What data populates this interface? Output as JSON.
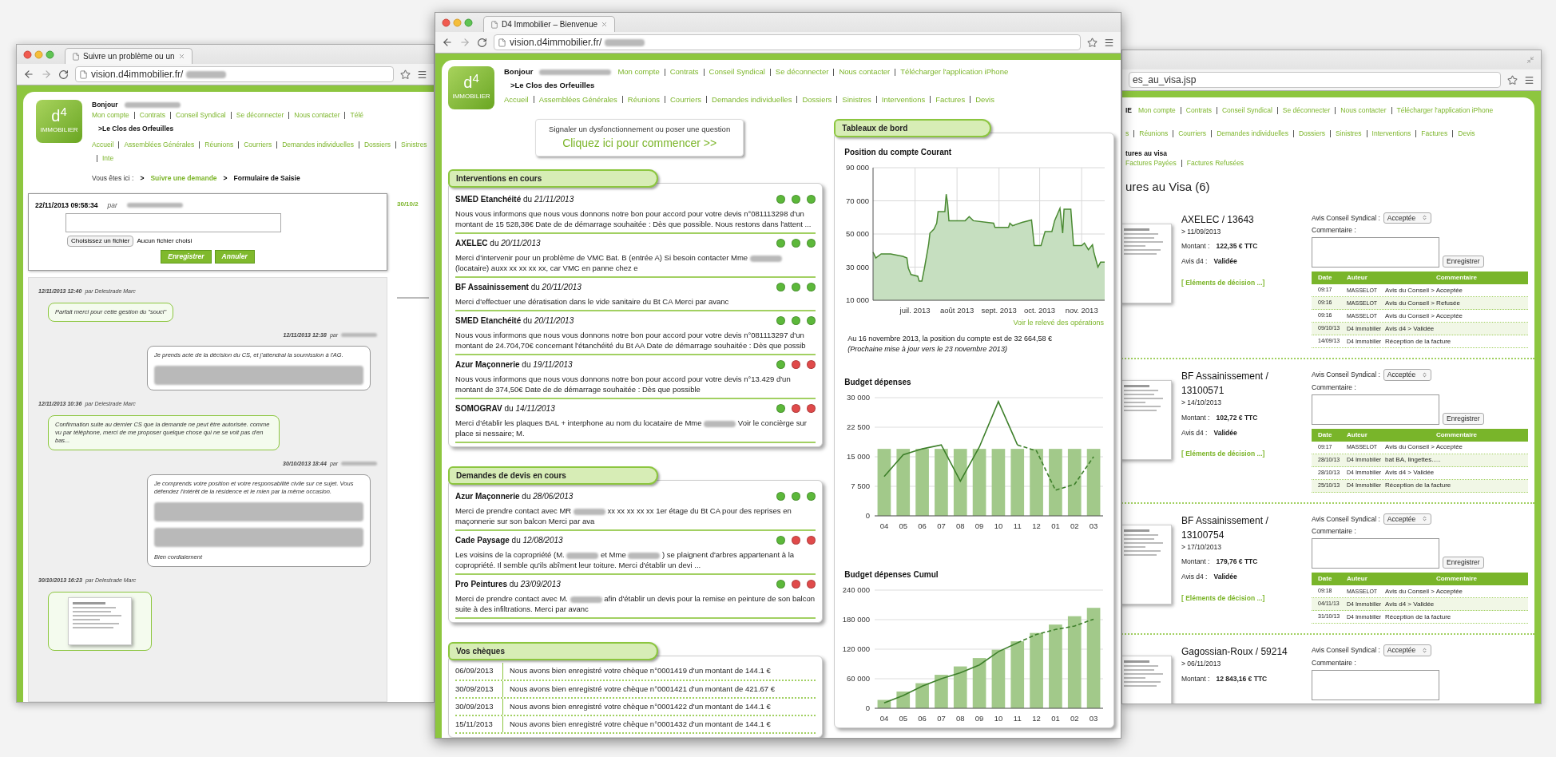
{
  "left_window": {
    "tab_title": "Suivre un problème ou un",
    "url": "vision.d4immobilier.fr/",
    "logo": {
      "mark": "d$^{4}$",
      "tagline": "IMMOBILIER"
    },
    "greeting": "Bonjour",
    "residence": ">Le Clos des Orfeuilles",
    "top_links": [
      "Mon compte",
      "Contrats",
      "Conseil Syndical",
      "Se déconnecter",
      "Nous contacter",
      "Télé"
    ],
    "nav_links": [
      "Accueil",
      "Assemblées Générales",
      "Réunions",
      "Courriers",
      "Demandes individuelles",
      "Dossiers",
      "Sinistres",
      "Inte"
    ],
    "breadcrumb": {
      "label": "Vous êtes ici :",
      "separator": ">",
      "items": [
        {
          "text": "Suivre une demande",
          "kind": "link"
        },
        {
          "text": "Formulaire de Saisie",
          "kind": "current"
        }
      ]
    },
    "form": {
      "timestamp": "22/11/2013 09:58:34",
      "by": "par",
      "file_button": "Choisissez un fichier",
      "file_status": "Aucun fichier choisi",
      "buttons": [
        "Enregistrer",
        "Annuler"
      ]
    },
    "side_date": "30/10/2",
    "messages": [
      {
        "kind": "left",
        "date": "12/11/2013 12:40",
        "by": "par Delestrade Marc",
        "body": [
          {
            "kind": "text",
            "text": "Parfait merci pour cette gestion du \"souci\""
          }
        ]
      },
      {
        "kind": "right",
        "date": "12/11/2013 12:38",
        "by": "par",
        "body": [
          {
            "kind": "text",
            "text": "Je prends acte de la décision du CS, et j'attendrai la soumission à l'AG."
          },
          {
            "kind": "blurred"
          }
        ]
      },
      {
        "kind": "left",
        "date": "12/11/2013 10:36",
        "by": "par Delestrade Marc",
        "body": [
          {
            "kind": "text",
            "text": "Confirmation suite au dernier CS que la demande ne peut être autorisée. comme vu par téléphone, merci de me proposer quelque chose qui ne se voit pas d'en bas..."
          }
        ]
      },
      {
        "kind": "right",
        "date": "30/10/2013 18:44",
        "by": "par",
        "body": [
          {
            "kind": "text",
            "text": "Je comprends votre position et votre responsabilité civile sur ce sujet. Vous défendez l'intérêt de la résidence et le mien par la même occasion."
          },
          {
            "kind": "blurred"
          },
          {
            "kind": "blurred"
          },
          {
            "kind": "text",
            "text": "Bien cordialement"
          }
        ]
      },
      {
        "kind": "left",
        "date": "30/10/2013 16:23",
        "by": "par Delestrade Marc",
        "body": [
          {
            "kind": "document"
          }
        ]
      }
    ]
  },
  "center_window": {
    "tab_title": "D4 Immobilier – Bienvenue",
    "url": "vision.d4immobilier.fr/",
    "logo": {
      "mark": "d$^{4}$",
      "tagline": "IMMOBILIER"
    },
    "greeting": "Bonjour",
    "residence": ">Le Clos des Orfeuilles",
    "top_links": [
      "Mon compte",
      "Contrats",
      "Conseil Syndical",
      "Se déconnecter",
      "Nous contacter",
      "Télécharger l'application iPhone"
    ],
    "nav_links": [
      "Accueil",
      "Assemblées Générales",
      "Réunions",
      "Courriers",
      "Demandes individuelles",
      "Dossiers",
      "Sinistres",
      "Interventions",
      "Factures",
      "Devis"
    ],
    "cta": {
      "prompt": "Signaler un dysfonctionnement ou poser une question",
      "link": "Cliquez ici pour commencer >>"
    },
    "interventions": {
      "title": "Interventions en cours",
      "items": [
        {
          "title": "**SMED Etanchéité** du *21/11/2013*",
          "lights": [
            {
              "color": "#5cb83a"
            },
            {
              "color": "#5cb83a"
            },
            {
              "color": "#5cb83a"
            }
          ],
          "text": [
            "Nous vous informons que nous vous donnons notre bon pour accord pour votre devis n°081113298 d'un montant de 15 528,38€ Date de de démarrage souhaitée : Dès que possible. Nous restons dans l'attent ..."
          ]
        },
        {
          "title": "**AXELEC** du *20/11/2013*",
          "lights": [
            {
              "color": "#5cb83a"
            },
            {
              "color": "#5cb83a"
            },
            {
              "color": "#5cb83a"
            }
          ],
          "text": [
            "Merci d'intervenir pour un problème de VMC Bat. B (entrée A) Si besoin contacter Mme",
            "(locataire) auxx xx xx xx xx, car VMC en panne chez e"
          ]
        },
        {
          "title": "**BF Assainissement** du *20/11/2013*",
          "lights": [
            {
              "color": "#5cb83a"
            },
            {
              "color": "#5cb83a"
            },
            {
              "color": "#5cb83a"
            }
          ],
          "text": [
            "Merci d'effectuer une dératisation dans le vide sanitaire du Bt CA Merci par avanc"
          ]
        },
        {
          "title": "**SMED Etanchéité** du *20/11/2013*",
          "lights": [
            {
              "color": "#5cb83a"
            },
            {
              "color": "#5cb83a"
            },
            {
              "color": "#5cb83a"
            }
          ],
          "text": [
            "Nous vous informons que nous vous donnons notre bon pour accord pour votre devis n°081113297 d'un montant de 24.704,70€ concernant l'étanchéité du Bt AA Date de démarrage souhaitée : Dès que possib"
          ]
        },
        {
          "title": "**Azur Maçonnerie** du *19/11/2013*",
          "lights": [
            {
              "color": "#5cb83a"
            },
            {
              "color": "#e04a4a"
            },
            {
              "color": "#e04a4a"
            }
          ],
          "text": [
            "Nous vous informons que nous vous donnons notre bon pour accord pour votre devis n°13.429 d'un montant de 374,50€ Date de de démarrage souhaitée : Dès que possible"
          ]
        },
        {
          "title": "**SOMOGRAV** du *14/11/2013*",
          "lights": [
            {
              "color": "#5cb83a"
            },
            {
              "color": "#e04a4a"
            },
            {
              "color": "#e04a4a"
            }
          ],
          "text": [
            "Merci d'établir les plaques BAL + interphone au nom du locataire de Mme",
            "Voir le concièrge sur place si nessaire; M."
          ]
        }
      ]
    },
    "quotes": {
      "title": "Demandes de devis en cours",
      "items": [
        {
          "title": "**Azur Maçonnerie** du *28/06/2013*",
          "lights": [
            {
              "color": "#5cb83a"
            },
            {
              "color": "#5cb83a"
            },
            {
              "color": "#5cb83a"
            }
          ],
          "text": [
            "Merci de prendre contact avec MR",
            "xx xx xx xx xx 1er étage du Bt CA pour des reprises en maçonnerie sur son balcon Merci par ava"
          ]
        },
        {
          "title": "**Cade Paysage** du *12/08/2013*",
          "lights": [
            {
              "color": "#5cb83a"
            },
            {
              "color": "#e04a4a"
            },
            {
              "color": "#e04a4a"
            }
          ],
          "text": [
            "Les voisins de la copropriété (M.",
            "et Mme",
            ") se plaignent d'arbres appartenant à la copropriété. Il semble qu'ils abîment leur toiture. Merci d'établir un devi ..."
          ]
        },
        {
          "title": "**Pro Peintures** du *23/09/2013*",
          "lights": [
            {
              "color": "#5cb83a"
            },
            {
              "color": "#e04a4a"
            },
            {
              "color": "#e04a4a"
            }
          ],
          "text": [
            "Merci de prendre contact avec M.",
            "afin d'établir un devis pour la remise en peinture de son balcon suite à des infiltrations. Merci par avanc"
          ]
        }
      ]
    },
    "cheques": {
      "title": "Vos chèques",
      "rows": [
        {
          "date": "06/09/2013",
          "text": "Nous avons bien enregistré votre chèque n°0001419 d'un montant de 144.1 €"
        },
        {
          "date": "30/09/2013",
          "text": "Nous avons bien enregistré votre chèque n°0001421 d'un montant de 421.67 €"
        },
        {
          "date": "30/09/2013",
          "text": "Nous avons bien enregistré votre chèque n°0001422 d'un montant de 144.1 €"
        },
        {
          "date": "15/11/2013",
          "text": "Nous avons bien enregistré votre chèque n°0001432 d'un montant de 144.1 €"
        }
      ]
    },
    "dashboard": {
      "title": "Tableaux de bord",
      "account_chart": {
        "chart_data": {
          "type": "area",
          "title": "Position du compte Courant",
          "x": [
            "2013-05-31",
            "2013-06-02",
            "2013-06-06",
            "2013-06-13",
            "2013-06-22",
            "2013-06-25",
            "2013-06-26",
            "2013-06-28",
            "2013-07-03",
            "2013-07-04",
            "2013-07-06",
            "2013-07-08",
            "2013-07-11",
            "2013-07-12",
            "2013-07-15",
            "2013-07-17",
            "2013-07-18",
            "2013-07-23",
            "2013-07-24",
            "2013-07-25",
            "2013-07-26",
            "2013-08-07",
            "2013-08-10",
            "2013-08-13",
            "2013-08-28",
            "2013-08-29",
            "2013-09-08",
            "2013-09-09",
            "2013-09-11",
            "2013-09-18",
            "2013-09-25",
            "2013-09-27",
            "2013-10-02",
            "2013-10-05",
            "2013-10-10",
            "2013-10-12",
            "2013-10-16",
            "2013-10-18",
            "2013-10-19",
            "2013-10-24",
            "2013-10-26",
            "2013-11-01",
            "2013-11-03",
            "2013-11-06",
            "2013-11-09",
            "2013-11-10",
            "2013-11-13",
            "2013-11-15",
            "2013-11-18"
          ],
          "series": [
            {
              "color": "#4a8a32",
              "values": [
                39000,
                35500,
                38000,
                38000,
                36500,
                35500,
                29500,
                25500,
                24500,
                21500,
                21500,
                29500,
                43500,
                50500,
                53000,
                56500,
                63500,
                63500,
                74000,
                68500,
                58000,
                58000,
                60500,
                58000,
                56500,
                54000,
                54000,
                56500,
                55000,
                57000,
                58500,
                43000,
                43000,
                51500,
                51500,
                58000,
                65500,
                50500,
                65000,
                65000,
                43000,
                43000,
                44500,
                40500,
                43500,
                39000,
                30000,
                33000,
                33000
              ]
            }
          ],
          "xlim": [
            "2013-05-31",
            "2013-11-18"
          ],
          "ylim": [
            10000,
            90000
          ],
          "grid": true,
          "xticks": [
            {
              "value": "2013-07-01",
              "label": "juil. 2013"
            },
            {
              "value": "2013-08-01",
              "label": "août 2013"
            },
            {
              "value": "2013-09-01",
              "label": "sept. 2013"
            },
            {
              "value": "2013-10-01",
              "label": "oct. 2013"
            },
            {
              "value": "2013-11-01",
              "label": "nov. 2013"
            }
          ],
          "yticks": [
            {
              "value": 10000,
              "label": "10 000"
            },
            {
              "value": 30000,
              "label": "30 000"
            },
            {
              "value": 50000,
              "label": "50 000"
            },
            {
              "value": 70000,
              "label": "70 000"
            },
            {
              "value": 90000,
              "label": "90 000"
            }
          ]
        },
        "link": "Voir le relevé des opérations",
        "summary": "Au 16 novembre 2013, la position du compte est de 32 664,58 €",
        "note": "(Prochaine mise à jour vers le 23 novembre 2013)"
      },
      "budget_chart": {
        "chart_data": {
          "type": "bar",
          "title": "Budget dépenses",
          "categories": [
            "04",
            "05",
            "06",
            "07",
            "08",
            "09",
            "10",
            "11",
            "12",
            "01",
            "02",
            "03"
          ],
          "series": [
            {
              "type": "bar",
              "color": "#a2c98a",
              "values": [
                17000,
                17000,
                17000,
                17000,
                17000,
                17000,
                17000,
                17000,
                17000,
                17000,
                17000,
                17000
              ]
            },
            {
              "type": "line",
              "color": "#3d7f2a",
              "values": [
                10000,
                15500,
                17000,
                18000,
                8800,
                17500,
                29000,
                18000,
                null,
                null,
                null,
                null
              ]
            },
            {
              "type": "line",
              "line_style": "dashed",
              "color": "#3d7f2a",
              "values": [
                null,
                null,
                null,
                null,
                null,
                null,
                null,
                18000,
                16500,
                6500,
                8000,
                15000
              ]
            }
          ],
          "grid": true,
          "ylim": [
            0,
            30000
          ],
          "yticks": [
            {
              "value": 0,
              "label": "0"
            },
            {
              "value": 7500,
              "label": "7 500"
            },
            {
              "value": 15000,
              "label": "15 000"
            },
            {
              "value": 22500,
              "label": "22 500"
            },
            {
              "value": 30000,
              "label": "30 000"
            }
          ]
        }
      },
      "cumul_chart": {
        "chart_data": {
          "type": "bar",
          "title": "Budget dépenses Cumul",
          "categories": [
            "04",
            "05",
            "06",
            "07",
            "08",
            "09",
            "10",
            "11",
            "12",
            "01",
            "02",
            "03"
          ],
          "series": [
            {
              "type": "bar",
              "color": "#a2c98a",
              "values": [
                17000,
                34000,
                51000,
                68000,
                85000,
                102000,
                119000,
                136000,
                153000,
                170000,
                187000,
                204000
              ]
            },
            {
              "type": "line",
              "color": "#3d7f2a",
              "values": [
                11000,
                26000,
                45000,
                60000,
                72000,
                88000,
                115000,
                133000,
                null,
                null,
                null,
                null
              ]
            },
            {
              "type": "line",
              "line_style": "dashed",
              "color": "#3d7f2a",
              "values": [
                null,
                null,
                null,
                null,
                null,
                null,
                null,
                133000,
                150000,
                160000,
                167000,
                181000
              ]
            }
          ],
          "grid": true,
          "ylim": [
            0,
            240000
          ],
          "yticks": [
            {
              "value": 0,
              "label": "0"
            },
            {
              "value": 60000,
              "label": "60 000"
            },
            {
              "value": 120000,
              "label": "120 000"
            },
            {
              "value": 180000,
              "label": "180 000"
            },
            {
              "value": 240000,
              "label": "240 000"
            }
          ]
        }
      }
    }
  },
  "right_window": {
    "url": "es_au_visa.jsp",
    "header_fragment": "IE",
    "top_links": [
      "Mon compte",
      "Contrats",
      "Conseil Syndical",
      "Se déconnecter",
      "Nous contacter",
      "Télécharger l'application iPhone"
    ],
    "nav_links": [
      "s",
      "Réunions",
      "Courriers",
      "Demandes individuelles",
      "Dossiers",
      "Sinistres",
      "Interventions",
      "Factures",
      "Devis"
    ],
    "subnav": {
      "current": "tures au visa",
      "links": [
        "Factures Payées",
        "Factures Refusées"
      ]
    },
    "page_title": "ures au Visa (6)",
    "invoices": [
      {
        "title": "AXELEC / 13643",
        "date": "> 11/09/2013",
        "amount_label": "Montant :",
        "amount": "122,35 € TTC",
        "avis_label": "Avis d4 :",
        "avis": "Validée",
        "link": "[ Eléments de décision ...]",
        "council_label": "Avis Conseil Syndical :",
        "council_value": "Acceptée",
        "comment_label": "Commentaire :",
        "save": "Enregistrer",
        "columns": [
          "Date",
          "Auteur",
          "Commentaire"
        ],
        "history": [
          {
            "date": "09:17",
            "author": "MASSELOT",
            "comment": "Avis du Conseil > Acceptée"
          },
          {
            "date": "09:16",
            "author": "MASSELOT",
            "comment": "Avis du Conseil > Refusée"
          },
          {
            "date": "09:16",
            "author": "MASSELOT",
            "comment": "Avis du Conseil > Acceptée"
          },
          {
            "date": "09/10/13",
            "author": "D4 Immobilier",
            "comment": "Avis d4 > Validée"
          },
          {
            "date": "14/09/13",
            "author": "D4 Immobilier",
            "comment": "Réception de la facture"
          }
        ]
      },
      {
        "title": "BF Assainissement / 13100571",
        "date": "> 14/10/2013",
        "amount_label": "Montant :",
        "amount": "102,72 € TTC",
        "avis_label": "Avis d4 :",
        "avis": "Validée",
        "link": "[ Eléments de décision ...]",
        "council_label": "Avis Conseil Syndical :",
        "council_value": "Acceptée",
        "comment_label": "Commentaire :",
        "save": "Enregistrer",
        "columns": [
          "Date",
          "Auteur",
          "Commentaire"
        ],
        "history": [
          {
            "date": "09:17",
            "author": "MASSELOT",
            "comment": "Avis du Conseil > Acceptée"
          },
          {
            "date": "28/10/13",
            "author": "D4 Immobilier",
            "comment": "bat BA, lingettes....."
          },
          {
            "date": "28/10/13",
            "author": "D4 Immobilier",
            "comment": "Avis d4 > Validée"
          },
          {
            "date": "25/10/13",
            "author": "D4 Immobilier",
            "comment": "Réception de la facture"
          }
        ]
      },
      {
        "title": "BF Assainissement / 13100754",
        "date": "> 17/10/2013",
        "amount_label": "Montant :",
        "amount": "179,76 € TTC",
        "avis_label": "Avis d4 :",
        "avis": "Validée",
        "link": "[ Eléments de décision ...]",
        "council_label": "Avis Conseil Syndical :",
        "council_value": "Acceptée",
        "comment_label": "Commentaire :",
        "save": "Enregistrer",
        "columns": [
          "Date",
          "Auteur",
          "Commentaire"
        ],
        "history": [
          {
            "date": "09:18",
            "author": "MASSELOT",
            "comment": "Avis du Conseil > Acceptée"
          },
          {
            "date": "04/11/13",
            "author": "D4 Immobilier",
            "comment": "Avis d4 > Validée"
          },
          {
            "date": "31/10/13",
            "author": "D4 Immobilier",
            "comment": "Réception de la facture"
          }
        ]
      },
      {
        "title": "Gagossian-Roux / 59214",
        "date": "> 06/11/2013",
        "amount_label": "Montant :",
        "amount": "12 843,16 € TTC",
        "council_label": "Avis Conseil Syndical :",
        "council_value": "Acceptée",
        "comment_label": "Commentaire :"
      }
    ]
  }
}
